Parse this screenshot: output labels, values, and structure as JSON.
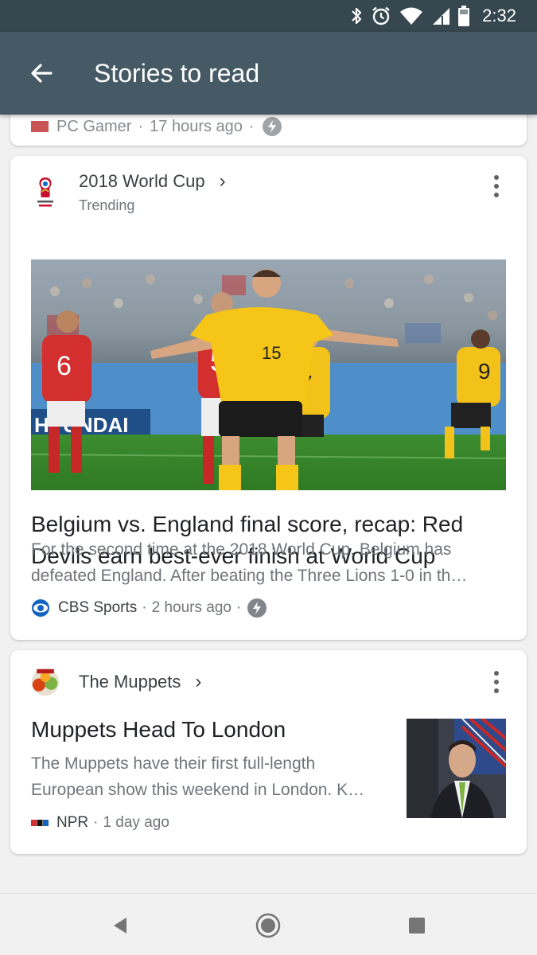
{
  "status_bar": {
    "time": "2:32",
    "icons": [
      "bluetooth-icon",
      "alarm-icon",
      "wifi-icon",
      "signal-icon",
      "battery-icon"
    ]
  },
  "app_bar": {
    "title": "Stories to read",
    "back_icon": "arrow-left-icon"
  },
  "previous_card": {
    "source": "PC Gamer",
    "time": "17 hours ago"
  },
  "cards": [
    {
      "topic": "2018 World Cup",
      "topic_sub": "Trending",
      "headline": "Belgium vs. England final score, recap: Red Devils earn best-ever finish at World Cup",
      "snippet_line1": "For the second time at the 2018 World Cup, Belgium has",
      "snippet_line2": "defeated England. After beating the Three Lions 1-0 in th…",
      "source": "CBS Sports",
      "time": "2 hours ago",
      "sep": "·",
      "image_banner_text": "HYUNDAI",
      "jersey_numbers": [
        "6",
        "5",
        "15",
        "7",
        "9"
      ]
    },
    {
      "topic": "The Muppets",
      "headline": "Muppets Head To London",
      "snippet_line1": "The Muppets have their first full-length",
      "snippet_line2": "European show this weekend in London. K…",
      "source": "NPR",
      "time": "1 day ago",
      "sep": "·"
    }
  ],
  "nav": {
    "back_icon": "triangle-back-icon",
    "home_icon": "circle-home-icon",
    "recents_icon": "square-recents-icon"
  },
  "colors": {
    "status_bar": "#37474f",
    "app_bar": "#455a64",
    "background": "#f1f1f1",
    "card": "#ffffff"
  }
}
